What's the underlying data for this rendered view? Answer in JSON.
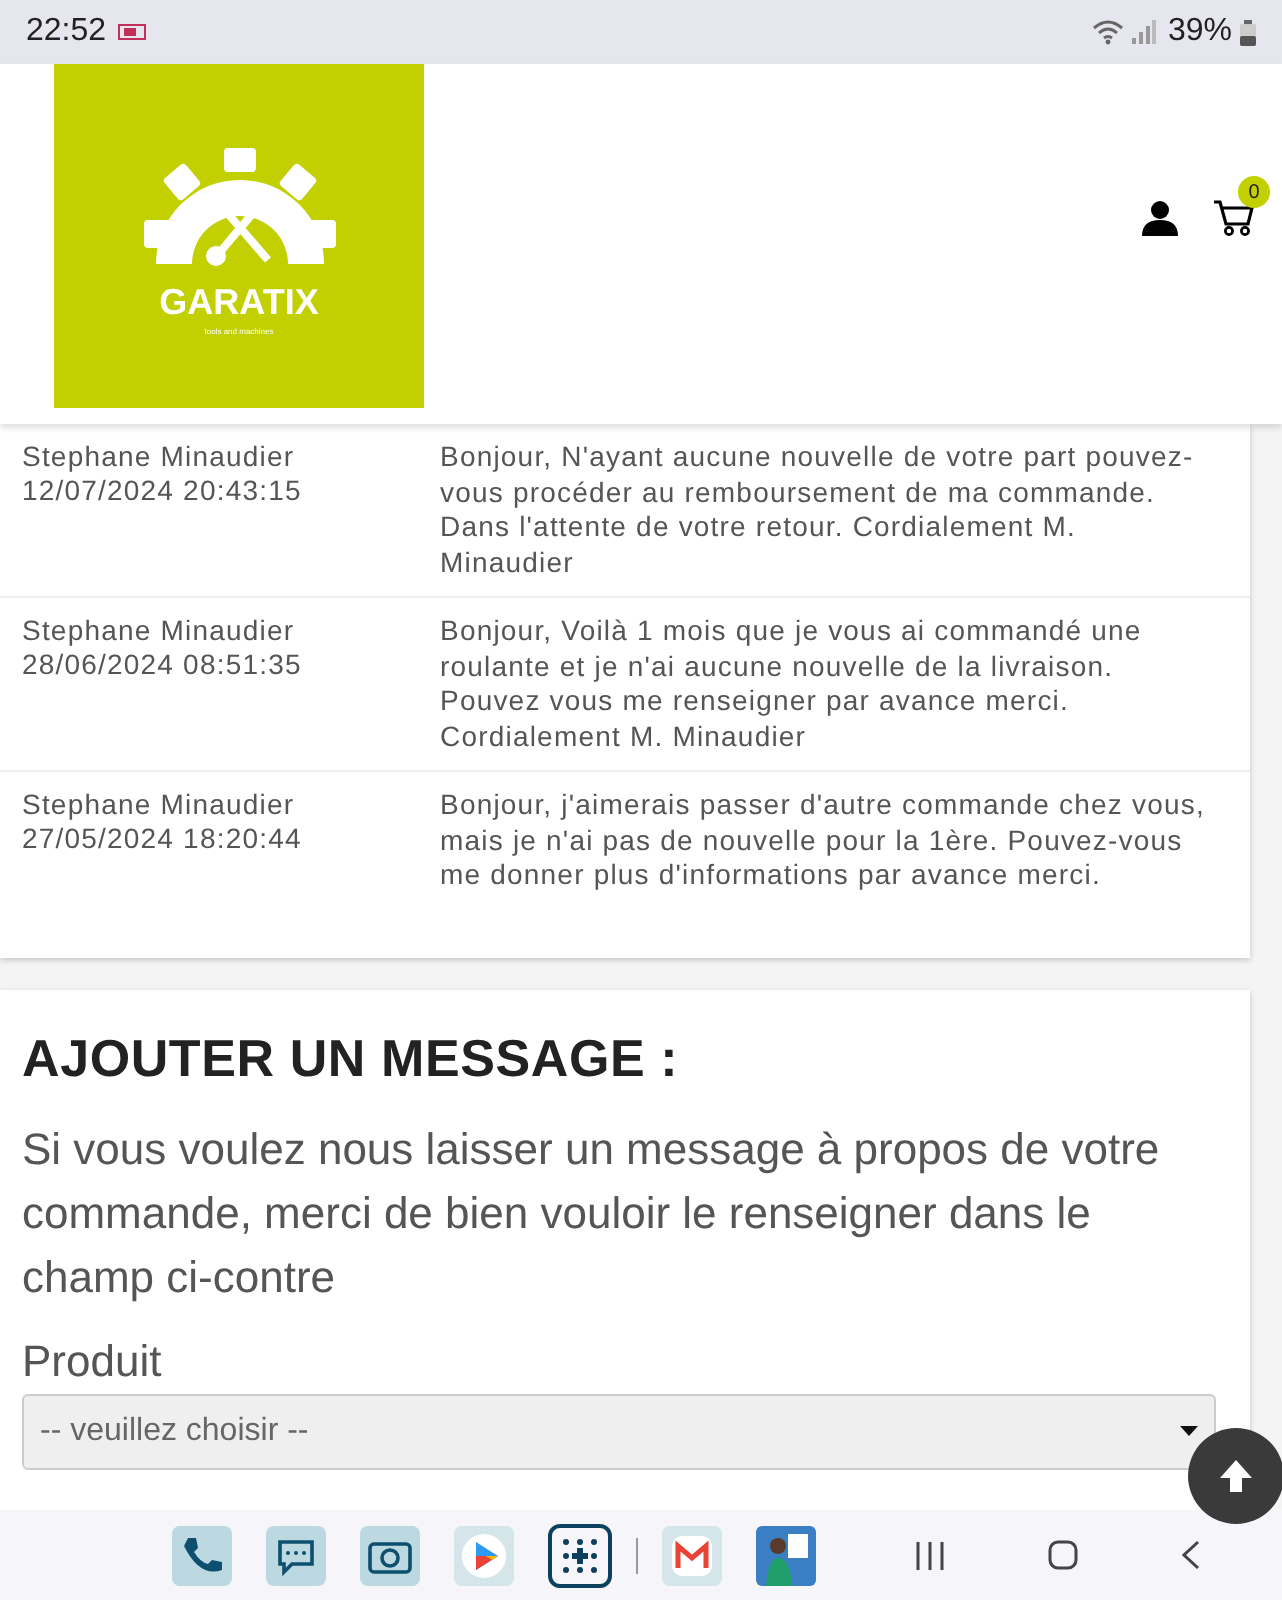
{
  "status_bar": {
    "time": "22:52",
    "battery": "39%"
  },
  "header": {
    "logo": {
      "name": "GARATIX",
      "tagline": "tools and machines"
    },
    "cart_count": "0"
  },
  "messages": [
    {
      "author": "Stephane Minaudier",
      "date": "12/07/2024 20:43:15",
      "text": "Bonjour, N'ayant aucune nouvelle de votre part pouvez-vous procéder au remboursement de ma commande. Dans l'attente de votre retour. Cordialement M. Minaudier"
    },
    {
      "author": "Stephane Minaudier",
      "date": "28/06/2024 08:51:35",
      "text": "Bonjour, Voilà 1 mois que je vous ai commandé une roulante et je n'ai aucune nouvelle de la livraison. Pouvez vous me renseigner par avance merci. Cordialement M. Minaudier"
    },
    {
      "author": "Stephane Minaudier",
      "date": "27/05/2024 18:20:44",
      "text": "Bonjour, j'aimerais passer d'autre commande chez vous, mais je n'ai pas de nouvelle pour la 1ère. Pouvez-vous me donner plus d'informations par avance merci."
    }
  ],
  "add_message": {
    "title": "AJOUTER UN MESSAGE :",
    "intro": "Si vous voulez nous laisser un message à propos de votre commande, merci de bien vouloir le renseigner dans le champ ci-contre",
    "product_label": "Produit",
    "product_select": {
      "placeholder": "-- veuillez choisir --"
    }
  }
}
